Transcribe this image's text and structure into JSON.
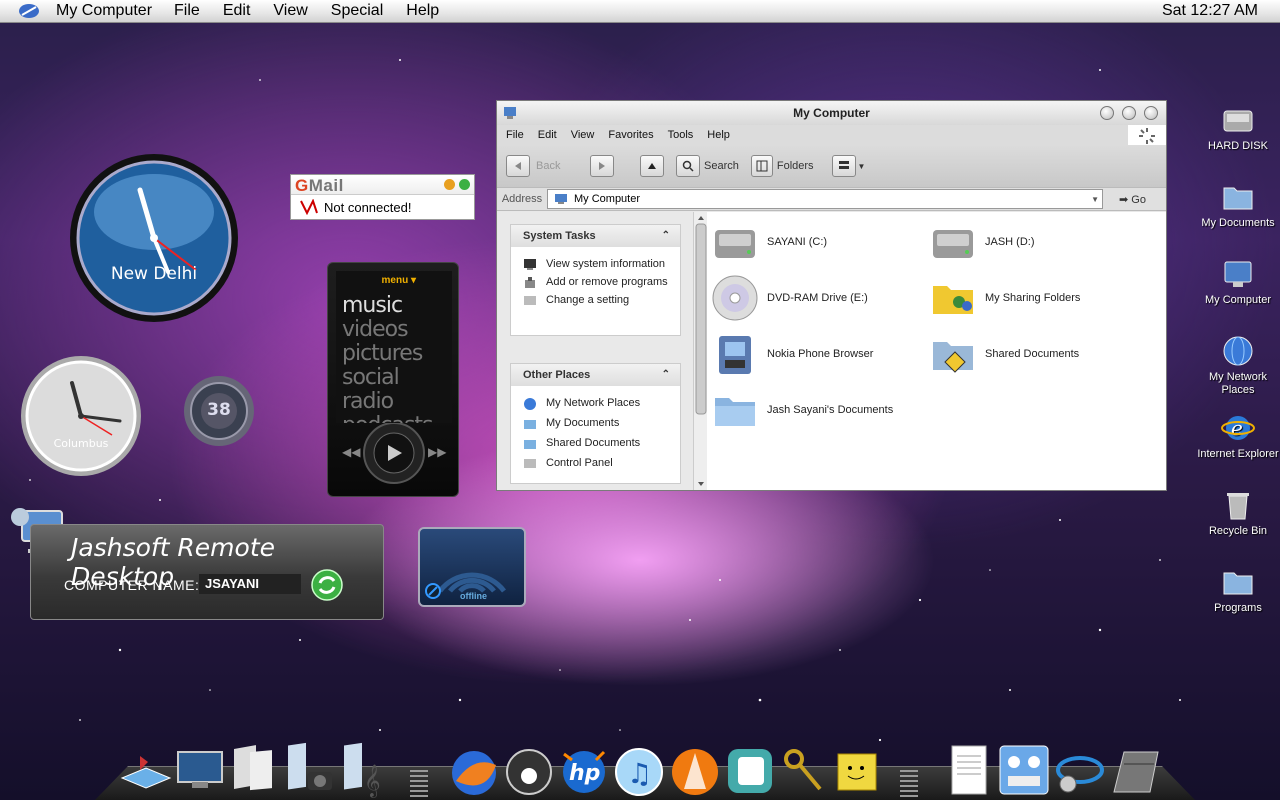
{
  "menubar": {
    "app_name": "My Computer",
    "items": [
      "File",
      "Edit",
      "View",
      "Special",
      "Help"
    ],
    "clock": "Sat 12:27 AM"
  },
  "widgets": {
    "clock1_city": "New Delhi",
    "clock2_city": "Columbus",
    "gauge_value": "38",
    "gmail": {
      "logo_g": "G",
      "logo_rest": "Mail",
      "status": "Not connected!"
    },
    "zune": {
      "menu_label": "menu ▾",
      "items": [
        "music",
        "videos",
        "pictures",
        "social",
        "radio",
        "podcasts"
      ]
    },
    "remote": {
      "title": "Jashsoft Remote Desktop",
      "computer_name_label": "COMPUTER NAME:",
      "computer_name_value": "JSAYANI"
    },
    "network": {
      "status": "offline"
    }
  },
  "window": {
    "title": "My Computer",
    "menu": [
      "File",
      "Edit",
      "View",
      "Favorites",
      "Tools",
      "Help"
    ],
    "toolbar": {
      "back": "Back",
      "search": "Search",
      "folders": "Folders"
    },
    "address_label": "Address",
    "address_value": "My Computer",
    "go_label": "Go",
    "system_tasks": {
      "title": "System Tasks",
      "items": [
        "View system information",
        "Add or remove programs",
        "Change a setting"
      ]
    },
    "other_places": {
      "title": "Other Places",
      "items": [
        "My Network Places",
        "My Documents",
        "Shared Documents",
        "Control Panel"
      ]
    },
    "files": [
      {
        "label": "SAYANI (C:)",
        "icon": "hard-disk-icon"
      },
      {
        "label": "JASH (D:)",
        "icon": "hard-disk-icon"
      },
      {
        "label": "DVD-RAM Drive (E:)",
        "icon": "dvd-icon"
      },
      {
        "label": "My Sharing Folders",
        "icon": "sharing-folder-icon"
      },
      {
        "label": "Nokia Phone Browser",
        "icon": "phone-browser-icon"
      },
      {
        "label": "Shared Documents",
        "icon": "shared-folder-icon"
      },
      {
        "label": "Jash Sayani's Documents",
        "icon": "folder-icon"
      }
    ]
  },
  "desktop_icons": [
    {
      "label": "HARD DISK"
    },
    {
      "label": "My Documents"
    },
    {
      "label": "My Computer"
    },
    {
      "label": "My Network Places"
    },
    {
      "label": "Internet Explorer"
    },
    {
      "label": "Recycle Bin"
    },
    {
      "label": "Programs"
    }
  ],
  "colors": {
    "menubar": "#e6e6e6",
    "clock_face": "#2f78c0",
    "window_chrome": "#d8d8d8",
    "accent_green": "#3cb043"
  }
}
